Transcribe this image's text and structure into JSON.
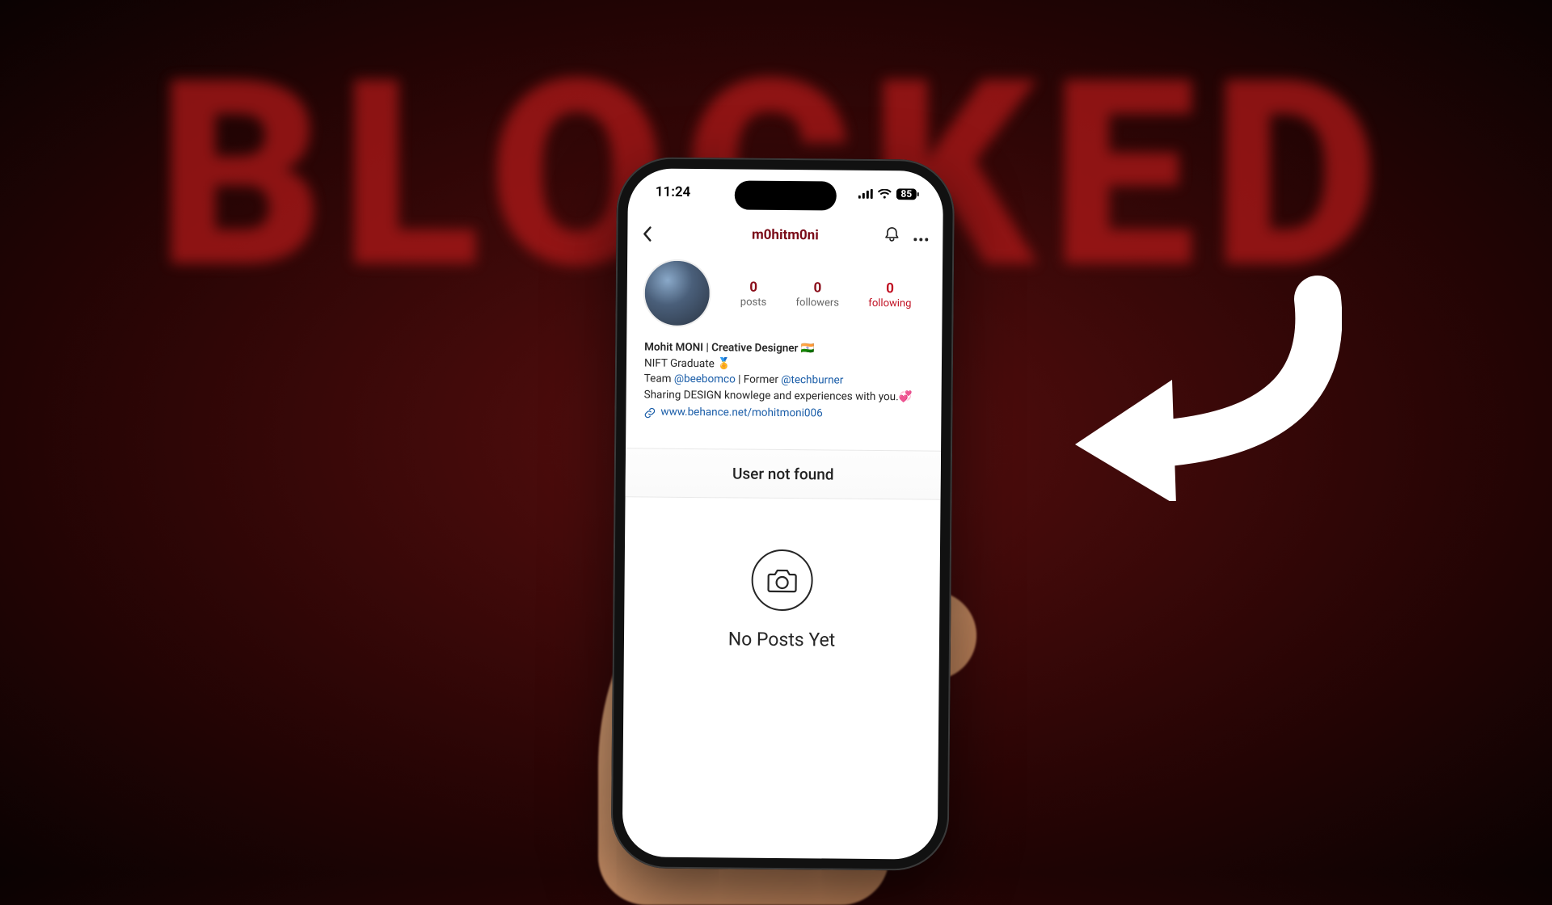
{
  "background": {
    "word": "BLOCKED"
  },
  "status": {
    "time": "11:24",
    "battery": "85"
  },
  "nav": {
    "username": "m0hitm0ni"
  },
  "stats": {
    "posts": {
      "count": "0",
      "label": "posts"
    },
    "followers": {
      "count": "0",
      "label": "followers"
    },
    "following": {
      "count": "0",
      "label": "following"
    }
  },
  "bio": {
    "display_name": "Mohit MONI | Creative Designer",
    "flag": "🇮🇳",
    "line2a": "NIFT Graduate ",
    "medal": "🏅",
    "line3_prefix": "Team ",
    "mention1": "@beebomco",
    "line3_mid": " | Former ",
    "mention2": "@techburner",
    "line4": "Sharing DESIGN knowlege and experiences with you.",
    "heart": "💞",
    "link_text": "www.behance.net/mohitmoni006"
  },
  "banner": {
    "message": "User not found"
  },
  "empty": {
    "text": "No Posts Yet"
  }
}
